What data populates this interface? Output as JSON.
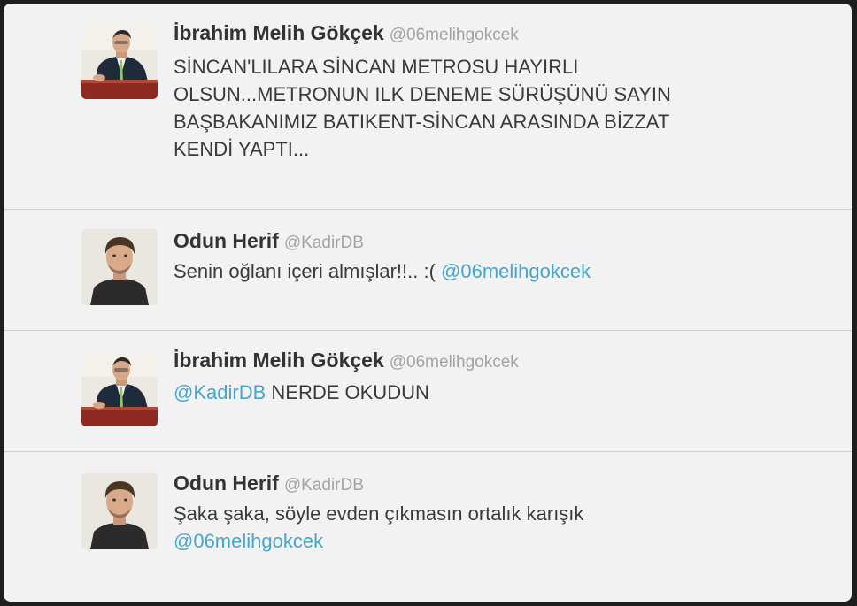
{
  "colors": {
    "card_background": "#f2f2f2",
    "divider": "#cfcfcf",
    "name": "#333333",
    "handle": "#a3a3a3",
    "text": "#3a3a3a",
    "mention": "#46a6cc"
  },
  "tweets": [
    {
      "name": "İbrahim Melih Gökçek",
      "handle": "@06melihgokcek",
      "avatar_icon": "man-in-suit-avatar",
      "lines": [
        "SİNCAN'LILARA SİNCAN METROSU HAYIRLI",
        "OLSUN...METRONUN ILK DENEME SÜRÜŞÜNÜ SAYIN",
        "BAŞBAKANIMIZ BATIKENT-SİNCAN ARASINDA BİZZAT",
        "KENDİ YAPTI..."
      ]
    },
    {
      "name": "Odun Herif",
      "handle": "@KadirDB",
      "avatar_icon": "young-man-avatar",
      "text": "Senin oğlanı içeri almışlar!!.. :(",
      "mention": "@06melihgokcek"
    },
    {
      "name": "İbrahim Melih Gökçek",
      "handle": "@06melihgokcek",
      "avatar_icon": "man-in-suit-avatar",
      "mention": "@KadirDB",
      "text": "NERDE OKUDUN"
    },
    {
      "name": "Odun Herif",
      "handle": "@KadirDB",
      "avatar_icon": "young-man-avatar",
      "text": "Şaka şaka, söyle evden çıkmasın ortalık karışık",
      "mention": "@06melihgokcek"
    }
  ]
}
